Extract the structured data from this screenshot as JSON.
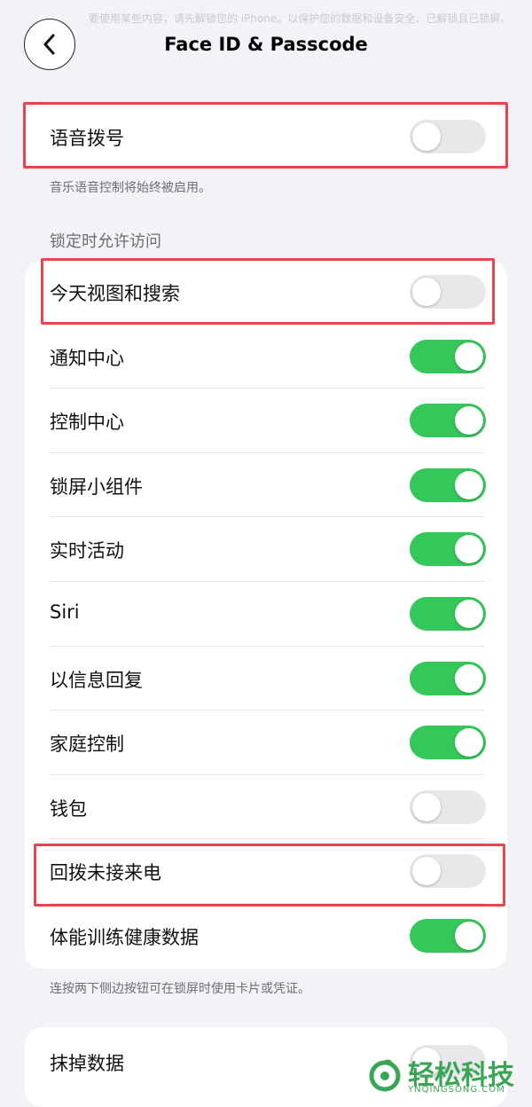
{
  "header": {
    "title": "Face ID & Passcode",
    "faded_text": "要使用某些内容，请先解锁您的 iPhone。以保护您的数据和设备安全、已解锁且已锁屏。"
  },
  "voice_dial": {
    "label": "语音拨号",
    "on": false
  },
  "voice_footnote": "音乐语音控制将始终被启用。",
  "locked_section": {
    "header": "锁定时允许访问",
    "items": [
      {
        "label": "今天视图和搜索",
        "on": false
      },
      {
        "label": "通知中心",
        "on": true
      },
      {
        "label": "控制中心",
        "on": true
      },
      {
        "label": "锁屏小组件",
        "on": true
      },
      {
        "label": "实时活动",
        "on": true
      },
      {
        "label": "Siri",
        "on": true
      },
      {
        "label": "以信息回复",
        "on": true
      },
      {
        "label": "家庭控制",
        "on": true
      },
      {
        "label": "钱包",
        "on": false
      },
      {
        "label": "回拨未接来电",
        "on": false
      },
      {
        "label": "体能训练健康数据",
        "on": true
      }
    ],
    "footnote": "连按两下侧边按钮可在锁屏时使用卡片或凭证。"
  },
  "erase": {
    "label": "抹掉数据",
    "on": false
  },
  "watermark": {
    "text": "轻松科技",
    "sub": "YNQINGSONG.COM"
  },
  "colors": {
    "toggle_on": "#34c759",
    "toggle_off": "#e8e8ea",
    "highlight": "#e4464f",
    "background": "#f2f2f7"
  }
}
